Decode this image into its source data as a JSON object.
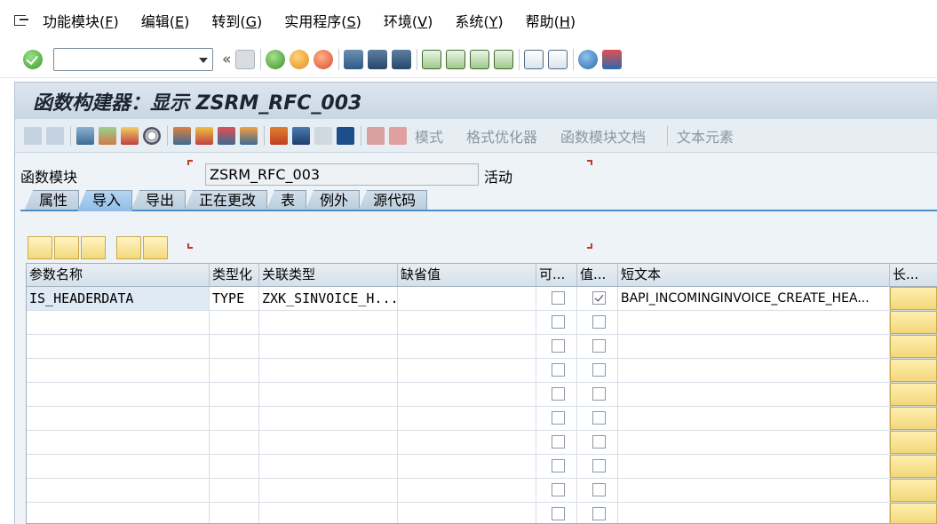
{
  "menu": {
    "items": [
      {
        "label": "功能模块(",
        "key": "F",
        "end": ")"
      },
      {
        "label": "编辑(",
        "key": "E",
        "end": ")"
      },
      {
        "label": "转到(",
        "key": "G",
        "end": ")"
      },
      {
        "label": "实用程序(",
        "key": "S",
        "end": ")"
      },
      {
        "label": "环境(",
        "key": "V",
        "end": ")"
      },
      {
        "label": "系统(",
        "key": "Y",
        "end": ")"
      },
      {
        "label": "帮助(",
        "key": "H",
        "end": ")"
      }
    ]
  },
  "toolbar": {
    "command_value": "",
    "chevron": "«"
  },
  "title": "函数构建器：显示 ZSRM_RFC_003",
  "app_toolbar": {
    "text_buttons": [
      "模式",
      "格式优化器",
      "函数模块文档",
      "文本元素"
    ]
  },
  "form": {
    "fm_label": "函数模块",
    "fm_value": "ZSRM_RFC_003",
    "status": "活动"
  },
  "tabs": [
    "属性",
    "导入",
    "导出",
    "正在更改",
    "表",
    "例外",
    "源代码"
  ],
  "active_tab": 1,
  "table": {
    "headers": [
      "参数名称",
      "类型化",
      "关联类型",
      "缺省值",
      "可...",
      "值...",
      "短文本",
      "长..."
    ],
    "rows": [
      {
        "name": "IS_HEADERDATA",
        "typing": "TYPE",
        "assoc": "ZXK_SINVOICE_H...",
        "default": "",
        "optional": false,
        "value": true,
        "short": "BAPI_INCOMINGINVOICE_CREATE_HEA..."
      }
    ],
    "empty_rows": 9
  },
  "colors": {
    "accent": "#4a8ccc",
    "title_bg": "#c9d6e3",
    "toolbar_bg": "#e6edf3"
  }
}
